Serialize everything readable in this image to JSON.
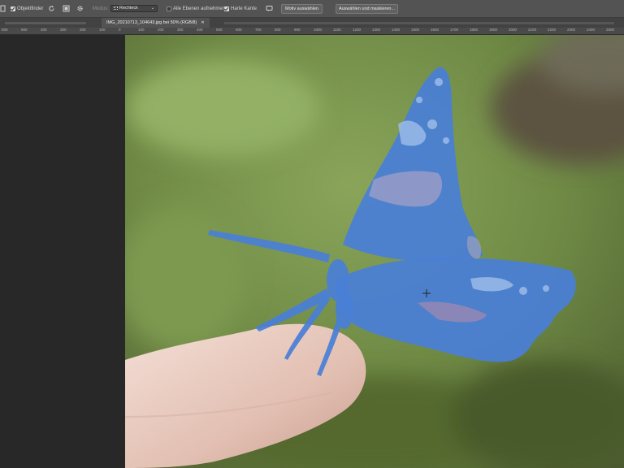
{
  "options_bar": {
    "object_finder_label": "Objektfinder",
    "mode_label": "Modus:",
    "mode_value": "Rechteck",
    "sample_all_layers_label": "Alle Ebenen aufnehmen",
    "hard_edge_label": "Harte Kante",
    "select_subject_label": "Motiv auswählen",
    "select_and_mask_label": "Auswählen und maskieren..."
  },
  "document_tab": {
    "title": "IMG_20210713_104643.jpg bei 50% (RGB/8)"
  },
  "ruler": {
    "labels": [
      "600",
      "500",
      "400",
      "300",
      "200",
      "100",
      "0",
      "100",
      "200",
      "300",
      "400",
      "500",
      "600",
      "700",
      "800",
      "900",
      "1000",
      "1100",
      "1200",
      "1300",
      "1400",
      "1500",
      "1600",
      "1700",
      "1800",
      "1900",
      "2000",
      "2100",
      "2200",
      "2300",
      "2400",
      "2500"
    ]
  },
  "colors": {
    "ui_panel": "#535353",
    "pasteboard": "#282828",
    "selection_overlay": "#4a7fd6"
  }
}
